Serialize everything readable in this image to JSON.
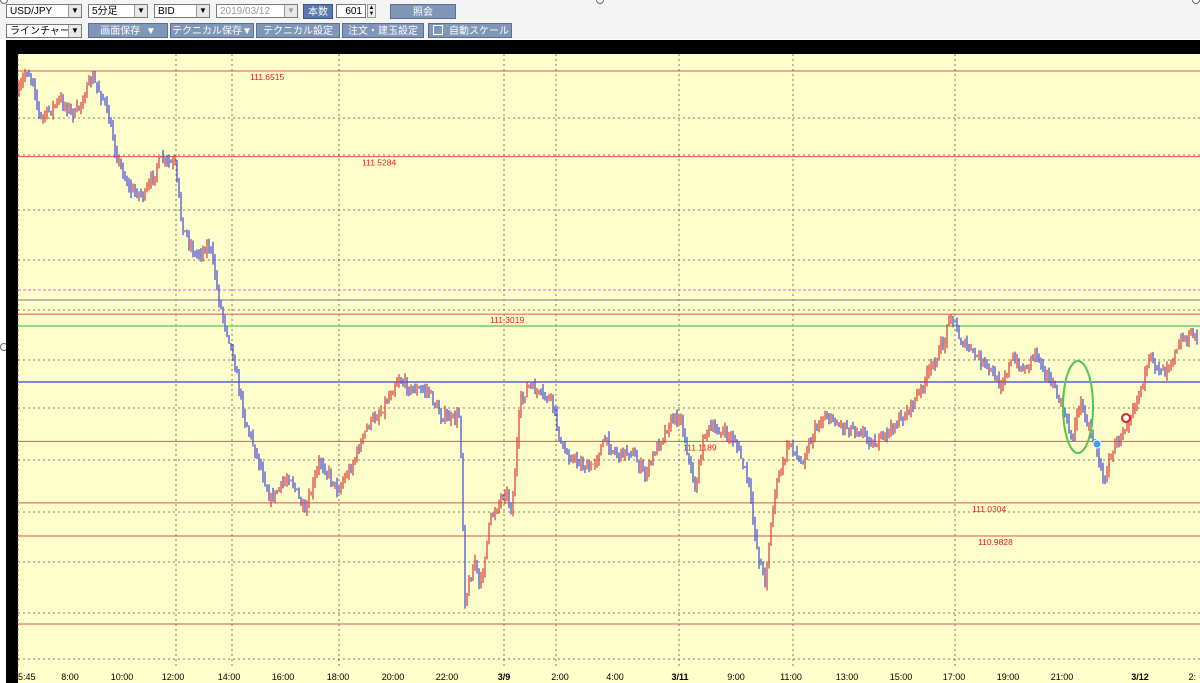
{
  "toolbar": {
    "symbol": "USD/JPY",
    "timeframe": "5分足",
    "price_type": "BID",
    "date": "2019/03/12",
    "count_label": "本数",
    "count_value": "601",
    "view_button": "照会",
    "chart_type": "ラインチャート",
    "save_screen": "画面保存",
    "save_technical": "テクニカル保存▼",
    "technical_settings": "テクニカル設定",
    "order_settings": "注文・建玉設定",
    "auto_scale": "自動スケール"
  },
  "colors": {
    "background": "#ffffcc",
    "up": "#e0443c",
    "down": "#4a55d4",
    "red_line": "#e05050",
    "blue_line": "#5560d8",
    "green_line": "#54c454",
    "magenta_line": "#e060e0",
    "grid": "#555555"
  },
  "chart_data": {
    "type": "candlestick",
    "symbol_label": "USD/JPY",
    "x_tick_labels": [
      "5:45",
      "8:00",
      "10:00",
      "12:00",
      "14:00",
      "16:00",
      "18:00",
      "20:00",
      "22:00",
      "3/9",
      "2:00",
      "4:00",
      "3/11",
      "9:00",
      "11:00",
      "13:00",
      "15:00",
      "17:00",
      "19:00",
      "21:00",
      "3/12",
      "2:"
    ],
    "levels": [
      {
        "label": "111.6515",
        "value": 111.6515,
        "color": "red"
      },
      {
        "label": "111.5284",
        "value": 111.5284,
        "color": "red"
      },
      {
        "label": "111.3019",
        "value": 111.3019,
        "color": "red"
      },
      {
        "label": "111.1189",
        "value": 111.1189,
        "color": "red"
      },
      {
        "label": "111.0304",
        "value": 111.0304,
        "color": "red"
      },
      {
        "label": "110.9828",
        "value": 110.9828,
        "color": "red"
      }
    ],
    "markers": [
      {
        "type": "ellipse",
        "color": "green"
      },
      {
        "type": "dot",
        "color": "blue"
      },
      {
        "type": "dot",
        "color": "red"
      }
    ]
  }
}
